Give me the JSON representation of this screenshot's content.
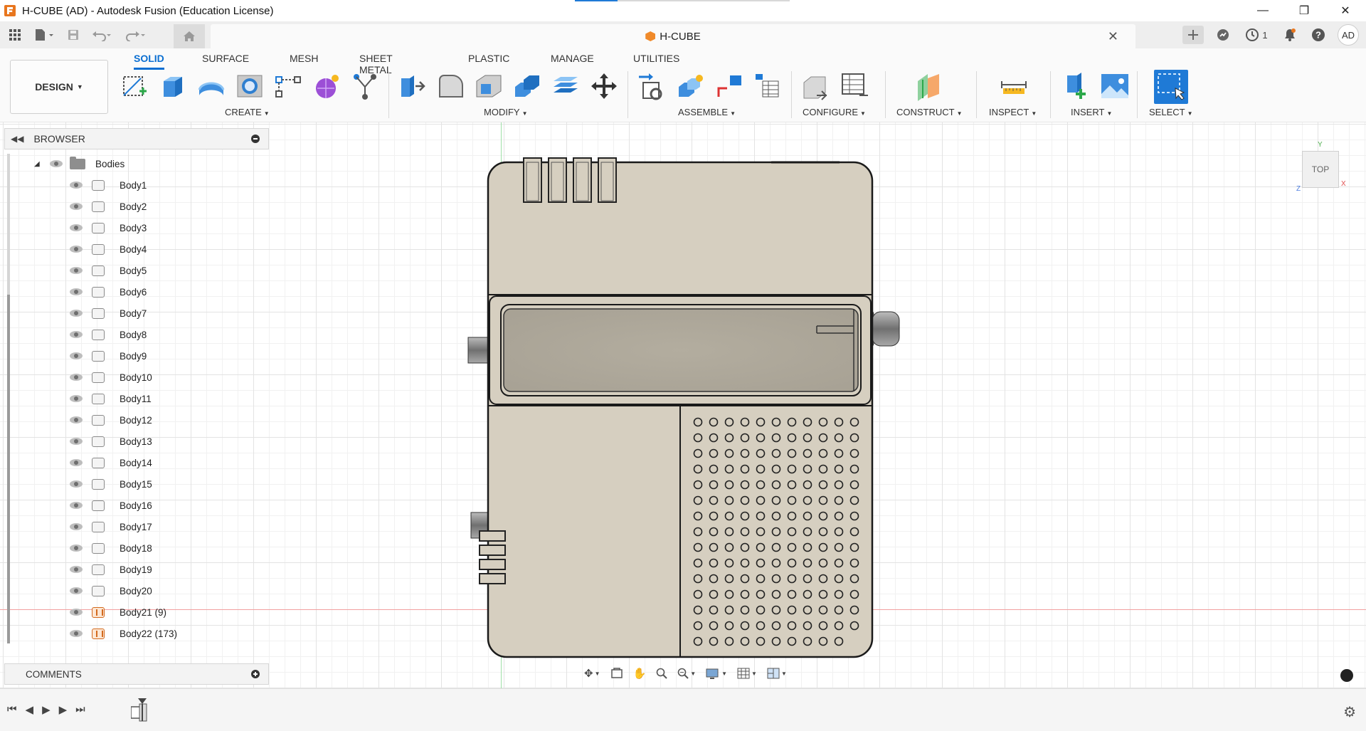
{
  "window": {
    "title": "H-CUBE (AD) - Autodesk Fusion (Education License)",
    "minimize": "—",
    "maximize": "❐",
    "close": "✕"
  },
  "tabbar": {
    "document_title": "H-CUBE",
    "close": "✕",
    "jobs_count": "1",
    "avatar_initials": "AD"
  },
  "ribbon": {
    "workspace": "DESIGN",
    "tabs": [
      {
        "label": "SOLID",
        "active": true
      },
      {
        "label": "SURFACE",
        "active": false
      },
      {
        "label": "MESH",
        "active": false
      },
      {
        "label": "SHEET METAL",
        "active": false
      },
      {
        "label": "PLASTIC",
        "active": false
      },
      {
        "label": "MANAGE",
        "active": false
      },
      {
        "label": "UTILITIES",
        "active": false
      }
    ],
    "groups": [
      {
        "label": "CREATE"
      },
      {
        "label": "MODIFY"
      },
      {
        "label": "ASSEMBLE"
      },
      {
        "label": "CONFIGURE"
      },
      {
        "label": "CONSTRUCT"
      },
      {
        "label": "INSPECT"
      },
      {
        "label": "INSERT"
      },
      {
        "label": "SELECT"
      }
    ]
  },
  "browser": {
    "title": "BROWSER",
    "folder": "Bodies",
    "bodies": [
      {
        "label": "Body1"
      },
      {
        "label": "Body2"
      },
      {
        "label": "Body3"
      },
      {
        "label": "Body4"
      },
      {
        "label": "Body5"
      },
      {
        "label": "Body6"
      },
      {
        "label": "Body7"
      },
      {
        "label": "Body8"
      },
      {
        "label": "Body9"
      },
      {
        "label": "Body10"
      },
      {
        "label": "Body11"
      },
      {
        "label": "Body12"
      },
      {
        "label": "Body13"
      },
      {
        "label": "Body14"
      },
      {
        "label": "Body15"
      },
      {
        "label": "Body16"
      },
      {
        "label": "Body17"
      },
      {
        "label": "Body18"
      },
      {
        "label": "Body19"
      },
      {
        "label": "Body20"
      },
      {
        "label": "Body21 (9)",
        "component": true
      },
      {
        "label": "Body22 (173)",
        "component": true
      }
    ]
  },
  "comments": {
    "title": "COMMENTS"
  },
  "viewcube": {
    "face": "TOP",
    "x": "X",
    "y": "Y",
    "z": "Z"
  },
  "colors": {
    "accent": "#0a6ed1",
    "model_fill": "#d6cfc0",
    "model_edge": "#1a1a1a"
  }
}
